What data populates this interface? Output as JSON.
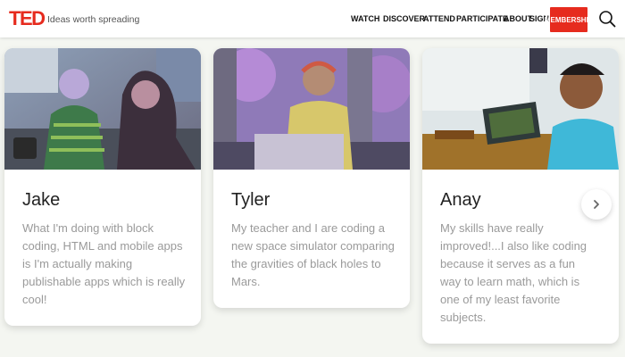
{
  "header": {
    "logo": "TED",
    "tagline": "Ideas worth spreading",
    "nav": [
      "WATCH",
      "DISCOVER",
      "ATTEND",
      "PARTICIPATE",
      "ABOUT",
      "SIGN IN"
    ],
    "membership_label": "MEMBERSHIP",
    "search_icon": "search-icon"
  },
  "cards": [
    {
      "name": "Jake",
      "quote": "What I'm doing with block coding, HTML and mobile apps is I'm actually making publishable apps which is really cool!"
    },
    {
      "name": "Tyler",
      "quote": "My teacher and I are coding a new space simulator comparing the gravities of black holes to Mars."
    },
    {
      "name": "Anay",
      "quote": "My skills have really improved!...I also like coding because it serves as a fun way to learn math, which is one of my least favorite subjects."
    }
  ],
  "carousel": {
    "next_icon": "chevron-right-icon"
  },
  "colors": {
    "brand": "#e62b1e",
    "background": "#f4f6f1",
    "card": "#ffffff",
    "quote_text": "#9a9a9a"
  }
}
